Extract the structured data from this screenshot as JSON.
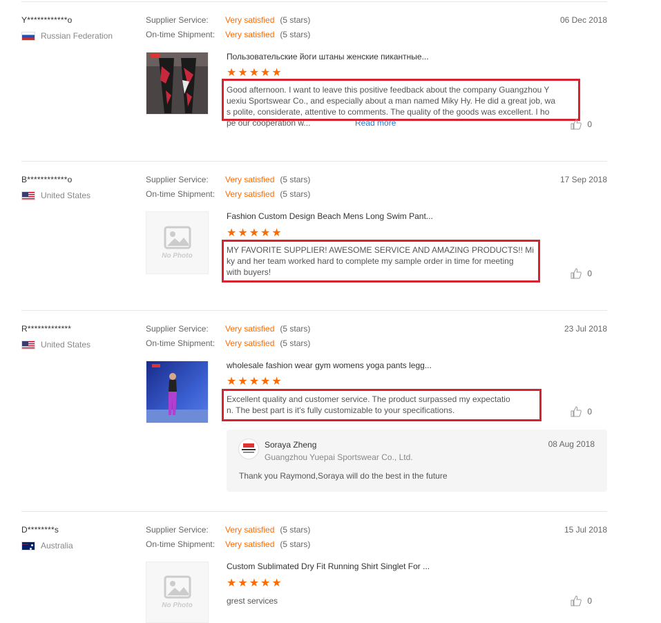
{
  "labels": {
    "supplier_service": "Supplier Service:",
    "ontime_shipment": "On-time Shipment:",
    "no_photo": "No Photo"
  },
  "reviews": [
    {
      "buyer": "Y************o",
      "country": "Russian Federation",
      "flag": "ru",
      "date": "06 Dec 2018",
      "supplier_rating": "Very satisfied",
      "supplier_stars": "(5 stars)",
      "shipment_rating": "Very satisfied",
      "shipment_stars": "(5 stars)",
      "product_title": "Пользовательские йоги штаны женские пикантные...",
      "stars": 5,
      "feedback_lines": [
        "Good afternoon. I want to leave this positive feedback about the company Guangzhou Y",
        "uexiu Sportswear Co., and especially about a man named Miky Hy. He did a great job, wa",
        "s polite, considerate, attentive to comments. The quality of the goods was excellent. I ho",
        "pe our cooperation w..."
      ],
      "read_more": "Read more",
      "likes": "0"
    },
    {
      "buyer": "B************o",
      "country": "United States",
      "flag": "us",
      "date": "17 Sep 2018",
      "supplier_rating": "Very satisfied",
      "supplier_stars": "(5 stars)",
      "shipment_rating": "Very satisfied",
      "shipment_stars": "(5 stars)",
      "product_title": "Fashion Custom Design Beach Mens Long Swim Pant...",
      "stars": 5,
      "feedback_lines": [
        "MY FAVORITE SUPPLIER! AWESOME SERVICE AND AMAZING PRODUCTS!! Mi",
        "ky and her team worked hard to complete my sample order in time for meeting",
        "with buyers!"
      ],
      "likes": "0"
    },
    {
      "buyer": "R*************",
      "country": "United States",
      "flag": "us",
      "date": "23 Jul 2018",
      "supplier_rating": "Very satisfied",
      "supplier_stars": "(5 stars)",
      "shipment_rating": "Very satisfied",
      "shipment_stars": "(5 stars)",
      "product_title": "wholesale fashion wear gym womens yoga pants legg...",
      "stars": 5,
      "feedback_lines": [
        "Excellent quality and customer service. The product surpassed my expectatio",
        "n. The best part is it's fully customizable to your specifications."
      ],
      "likes": "0",
      "reply": {
        "name": "Soraya Zheng",
        "company": "Guangzhou Yuepai Sportswear Co., Ltd.",
        "date": "08 Aug 2018",
        "text": "Thank you Raymond,Soraya will do the best in the future"
      }
    },
    {
      "buyer": "D********s",
      "country": "Australia",
      "flag": "au",
      "date": "15 Jul 2018",
      "supplier_rating": "Very satisfied",
      "supplier_stars": "(5 stars)",
      "shipment_rating": "Very satisfied",
      "shipment_stars": "(5 stars)",
      "product_title": "Custom Sublimated Dry Fit Running Shirt Singlet For ...",
      "stars": 5,
      "feedback_lines": [
        "grest services"
      ],
      "likes": "0"
    }
  ],
  "colors": {
    "accent": "#ff6a00",
    "highlight_box": "#d6232f",
    "link": "#1e7cd7"
  }
}
